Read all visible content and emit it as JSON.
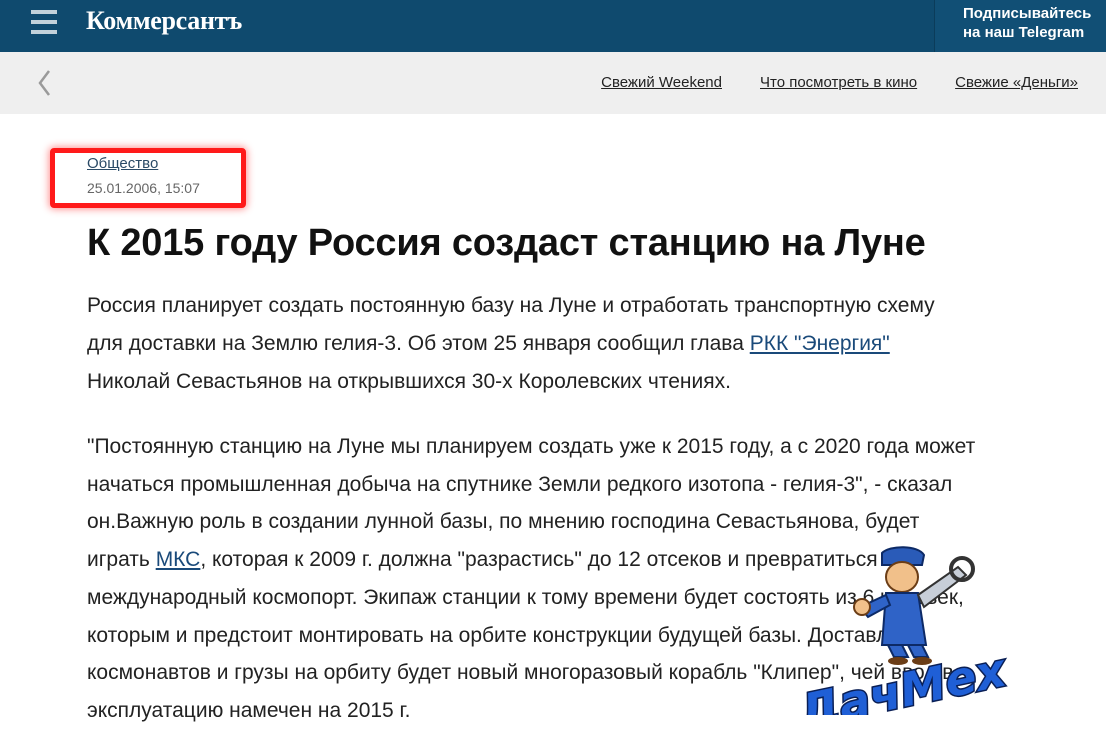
{
  "header": {
    "logo": "Коммерсантъ",
    "telegram_line1": "Подписывайтесь",
    "telegram_line2": "на наш Telegram"
  },
  "subnav": {
    "links": [
      "Свежий Weekend",
      "Что посмотреть в кино",
      "Свежие «Деньги»"
    ]
  },
  "article": {
    "rubric": "Общество",
    "date": "25.01.2006, 15:07",
    "title": "К 2015 году Россия создаст станцию на Луне",
    "lead_part1": "Россия планирует создать постоянную базу на Луне и отработать транспортную схему для доставки на Землю гелия-3. Об этом 25 января сообщил глава ",
    "lead_link": "РКК \"Энергия\"",
    "lead_part2": " Николай Севастьянов на открывшихся 30-х Королевских чтениях.",
    "body_part1": "\"Постоянную станцию на Луне мы планируем создать уже к 2015 году, а с 2020 года может начаться промышленная добыча на спутнике Земли редкого изотопа - гелия-3\", - сказал он.Важную роль в создании лунной базы, по мнению господина Севастьянова, будет играть ",
    "body_link": "МКС",
    "body_part2": ", которая к 2009 г. должна \"разрастись\" до 12 отсеков и превратиться в международный космопорт. Экипаж станции к тому времени будет состоять из 6 человек, которым и предстоит монтировать на орбите конструкции будущей базы. Доставлять космонавтов и грузы на орбиту будет новый многоразовый корабль \"Клипер\", чей ввод в эксплуатацию намечен на 2015 г."
  },
  "watermark": {
    "text": "ДачМех"
  },
  "colors": {
    "header_bg": "#0f4a6e",
    "subnav_bg": "#efefef",
    "highlight": "#ff1a1a"
  }
}
